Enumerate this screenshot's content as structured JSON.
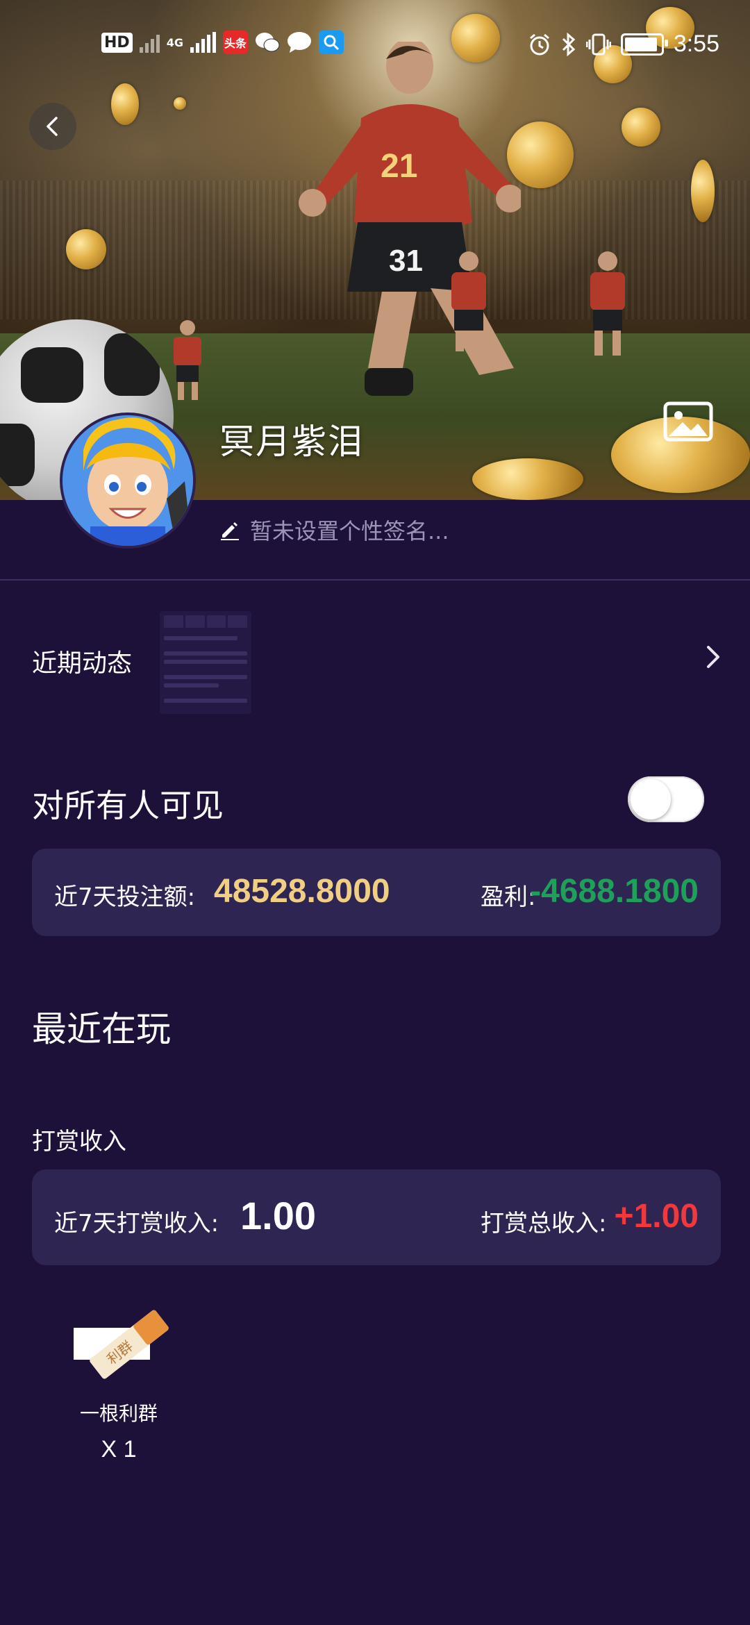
{
  "status_bar": {
    "left_icons": [
      "hd-2-icon",
      "no-signal-icon",
      "4g-signal-icon",
      "toutiao-app-icon",
      "wechat-icon",
      "message-icon",
      "search-app-icon"
    ],
    "hd_label": "HD",
    "network_label": "4G",
    "toutiao_label": "头条",
    "time": "3:55",
    "right_icons": [
      "alarm-icon",
      "bluetooth-icon",
      "vibrate-icon",
      "battery-icon"
    ]
  },
  "profile": {
    "username": "冥月紫泪",
    "signature_placeholder": "暂未设置个性签名...",
    "cover_icon": "image-icon",
    "back_icon": "chevron-left-icon"
  },
  "recent_activity": {
    "label": "近期动态"
  },
  "visibility": {
    "label": "对所有人可见",
    "enabled": false
  },
  "stake_card": {
    "stake_label": "近7天投注额:",
    "stake_value": "48528.8000",
    "profit_label": "盈利:",
    "profit_value": "-4688.1800"
  },
  "recent_playing": {
    "title": "最近在玩"
  },
  "tips": {
    "title": "打赏收入",
    "week_label": "近7天打赏收入:",
    "week_value": "1.00",
    "total_label": "打赏总收入:",
    "total_value": "+1.00"
  },
  "gifts": [
    {
      "name": "一根利群",
      "count": "X 1",
      "image_text": "利群"
    }
  ],
  "colors": {
    "background": "#1d1039",
    "card": "#2f2553",
    "stake_value": "#f0cf84",
    "profit_value": "#1fa05a",
    "tips_total": "#f0383d"
  }
}
